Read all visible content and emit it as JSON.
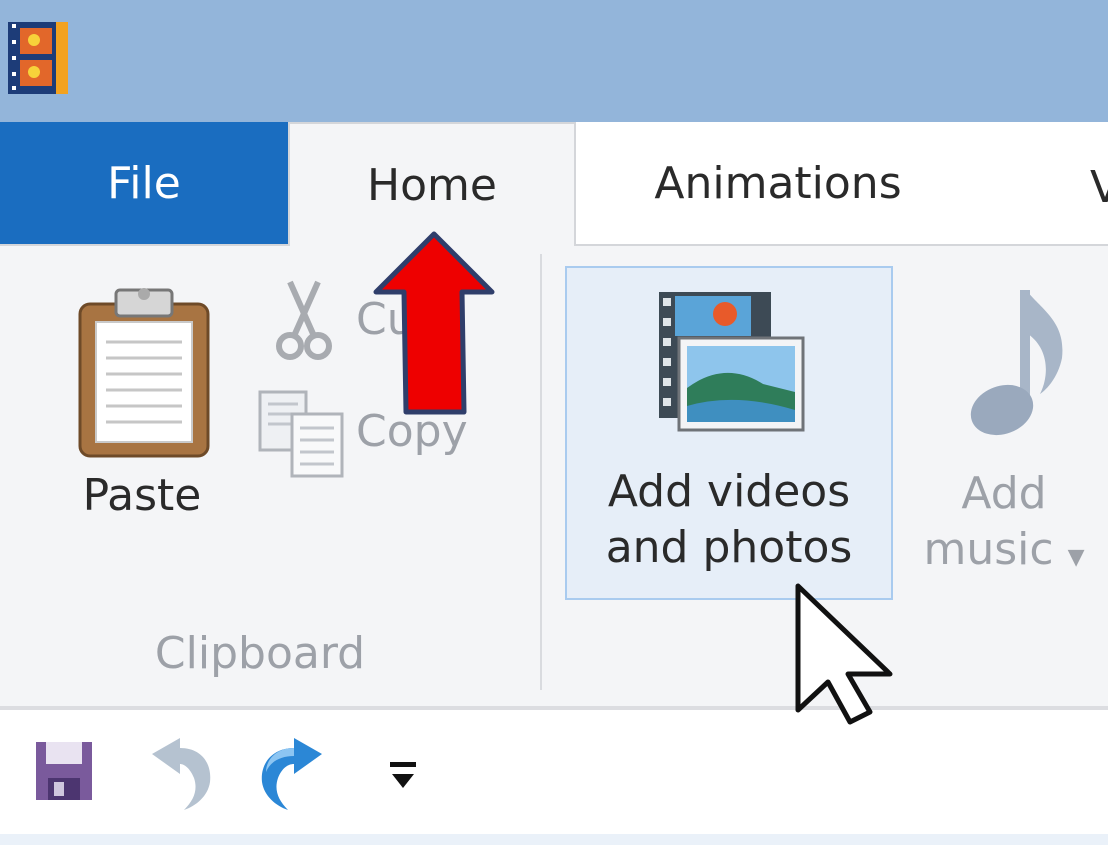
{
  "colors": {
    "titlebar": "#93b5da",
    "file_tab": "#1a6dc0",
    "ribbon_bg": "#f4f5f7",
    "hover_bg": "#e6eef8",
    "hover_border": "#a9cbef",
    "disabled_text": "#9da1a8",
    "annotation_arrow": "#ee0000"
  },
  "tabs": {
    "file": "File",
    "home": "Home",
    "animations": "Animations",
    "next_partial": "V"
  },
  "clipboard": {
    "paste_label": "Paste",
    "cut_label": "Cut",
    "copy_label": "Copy",
    "group_label": "Clipboard"
  },
  "add_group": {
    "add_videos_line1": "Add videos",
    "add_videos_line2": "and photos",
    "add_music_line1": "Add",
    "add_music_line2": "music"
  },
  "icons": {
    "app": "movie-maker-icon",
    "paste": "clipboard-icon",
    "cut": "scissors-icon",
    "copy": "copy-icon",
    "add_videos": "film-photo-icon",
    "add_music": "music-note-icon",
    "save": "floppy-disk-icon",
    "undo": "undo-icon",
    "redo": "redo-icon",
    "customize": "customize-toolbar-icon"
  }
}
